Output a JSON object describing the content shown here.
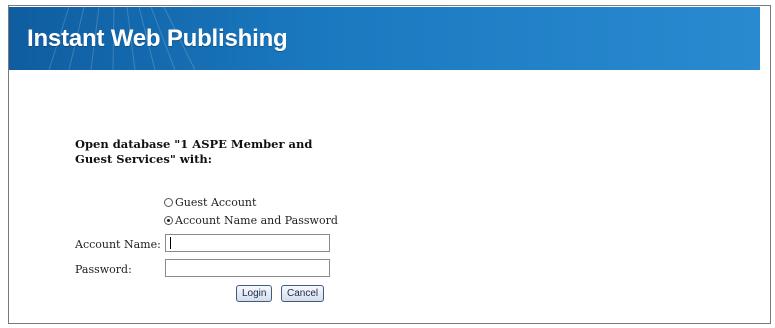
{
  "header": {
    "title": "Instant Web Publishing",
    "background_color": "#1a78bf"
  },
  "login": {
    "prompt": "Open database \"1 ASPE Member and Guest Services\" with:",
    "options": [
      {
        "label": "Guest Account",
        "selected": false
      },
      {
        "label": "Account Name and Password",
        "selected": true
      }
    ],
    "account_name_label": "Account Name:",
    "account_name_value": "",
    "password_label": "Password:",
    "password_value": "",
    "login_button": "Login",
    "cancel_button": "Cancel"
  }
}
